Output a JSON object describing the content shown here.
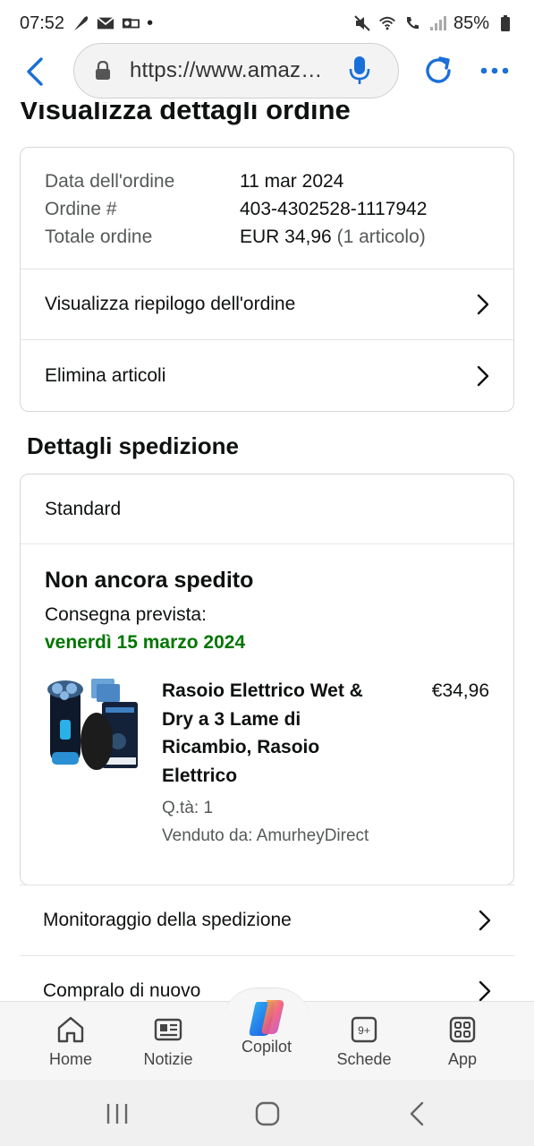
{
  "status_bar": {
    "time": "07:52",
    "dot": "•",
    "battery": "85%"
  },
  "browser": {
    "url": "https://www.amaz…",
    "icons": [
      "back-arrow-icon",
      "lock-icon",
      "microphone-icon",
      "reload-icon",
      "more-icon"
    ],
    "accent": "#1a6fd8"
  },
  "page": {
    "title": "Visualizza dettagli ordine",
    "order_info": [
      {
        "label": "Data dell'ordine",
        "value": "11 mar 2024",
        "extra": ""
      },
      {
        "label": "Ordine #",
        "value": "403-4302528-1117942",
        "extra": ""
      },
      {
        "label": "Totale ordine",
        "value": "EUR 34,96",
        "extra": "(1 articolo)"
      }
    ],
    "summary_link": "Visualizza riepilogo dell'ordine",
    "delete_link": "Elimina articoli",
    "shipping_section_title": "Dettagli spedizione",
    "shipping_method": "Standard",
    "shipment_status": "Non ancora spedito",
    "delivery_label": "Consegna prevista:",
    "delivery_date": "venerdì 15 marzo 2024",
    "delivery_color": "#007600",
    "product": {
      "title": "Rasoio Elettrico Wet & Dry a 3 Lame di Ricambio, Rasoio Elettrico",
      "qty": "Q.tà: 1",
      "seller": "Venduto da: AmurheyDirect",
      "price": "€34,96"
    },
    "tracking_link": "Monitoraggio della spedizione",
    "buy_again_link": "Compralo di nuovo"
  },
  "bottom_nav": {
    "items": [
      {
        "label": "Home",
        "icon": "home-icon"
      },
      {
        "label": "Notizie",
        "icon": "news-icon"
      },
      {
        "label": "Copilot",
        "icon": "copilot-icon"
      },
      {
        "label": "Schede",
        "icon": "tabs-icon"
      },
      {
        "label": "App",
        "icon": "apps-icon"
      }
    ],
    "tabs_count": "9+"
  },
  "system_nav": {
    "icons": [
      "recent-apps-icon",
      "home-button-icon",
      "back-button-icon"
    ]
  }
}
